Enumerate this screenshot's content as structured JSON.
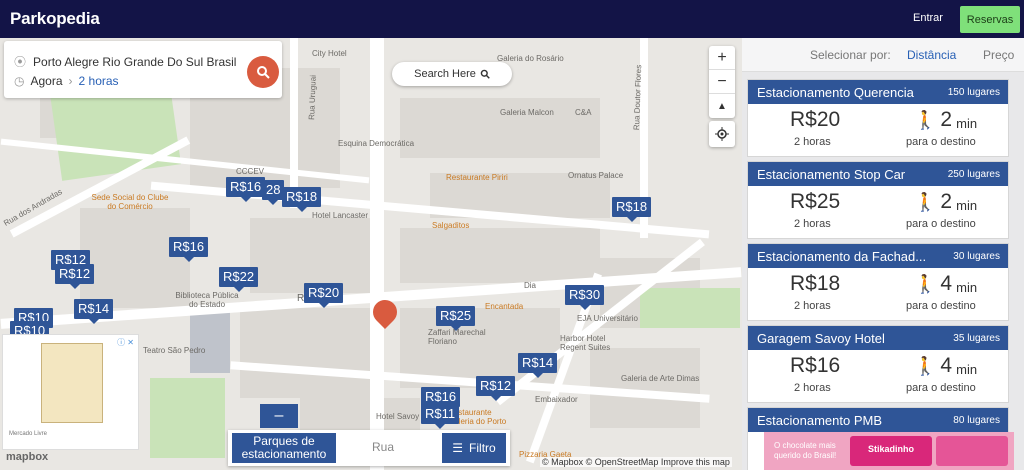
{
  "header": {
    "logo": "Parkopedia",
    "login": "Entrar",
    "reserve": "Reservas"
  },
  "search": {
    "location": "Porto Alegre Rio Grande Do Sul Brasil",
    "time_now": "Agora",
    "duration": "2 horas",
    "search_here": "Search Here"
  },
  "map": {
    "labels": [
      "City Hotel",
      "Galeria do Rosário",
      "Rua Uruguai",
      "Galeria Malcon",
      "C&A",
      "Rua Doutor Flores",
      "Esquina Democrática",
      "Restaurante Piriri",
      "Ornatus Palace",
      "Sede Social do Clube do Comércio",
      "Rua dos Andradas",
      "Hotel Lancaster",
      "Salgaditos",
      "Biblioteca Pública do Estado",
      "Encantada",
      "EJA Universitário",
      "Zaffari Marechal Floriano",
      "Harbor Hotel Regent Suites",
      "Dia",
      "Galeria de Arte Dimas",
      "Embaixador",
      "Hotel Savoy",
      "Pizzaria Gaeta",
      "Teatro São Pedro",
      "Ru   uelo",
      "CCCEV",
      "Restaurante Galeria do Porto"
    ],
    "prices": [
      "R$16",
      "28",
      "R$18",
      "R$18",
      "R$16",
      "R$12",
      "R$12",
      "R$22",
      "R$20",
      "R$30",
      "R$14",
      "R$25",
      "R$10",
      "R$10",
      "R$14",
      "R$12",
      "R$16",
      "R$11"
    ],
    "mapbox": "mapbox",
    "attribution": "© Mapbox © OpenStreetMap  Improve this map"
  },
  "ad_left": {
    "brand": "Mercado Livre",
    "badge": "ⓘ ✕"
  },
  "filters": {
    "parking_label": "Parques de estacionamento",
    "street_placeholder": "Rua",
    "filter_label": "Filtro"
  },
  "sort": {
    "label": "Selecionar por:",
    "distance": "Distância",
    "price": "Preço"
  },
  "results": [
    {
      "name": "Estacionamento Querencia",
      "spaces": "150 lugares",
      "price": "R$20",
      "duration": "2 horas",
      "walk": "2",
      "unit": "min",
      "dest": "para o destino"
    },
    {
      "name": "Estacionamento Stop Car",
      "spaces": "250 lugares",
      "price": "R$25",
      "duration": "2 horas",
      "walk": "2",
      "unit": "min",
      "dest": "para o destino"
    },
    {
      "name": "Estacionamento da Fachad...",
      "spaces": "30 lugares",
      "price": "R$18",
      "duration": "2 horas",
      "walk": "4",
      "unit": "min",
      "dest": "para o destino"
    },
    {
      "name": "Garagem Savoy Hotel",
      "spaces": "35 lugares",
      "price": "R$16",
      "duration": "2 horas",
      "walk": "4",
      "unit": "min",
      "dest": "para o destino"
    },
    {
      "name": "Estacionamento PMB",
      "spaces": "80 lugares"
    }
  ],
  "ad_right": {
    "text": "O chocolate mais querido do Brasil!",
    "brand": "Stikadinho"
  },
  "colors": {
    "header": "#131447",
    "accent": "#2f5597",
    "reserve": "#7fe07a",
    "search": "#d95b3f"
  }
}
